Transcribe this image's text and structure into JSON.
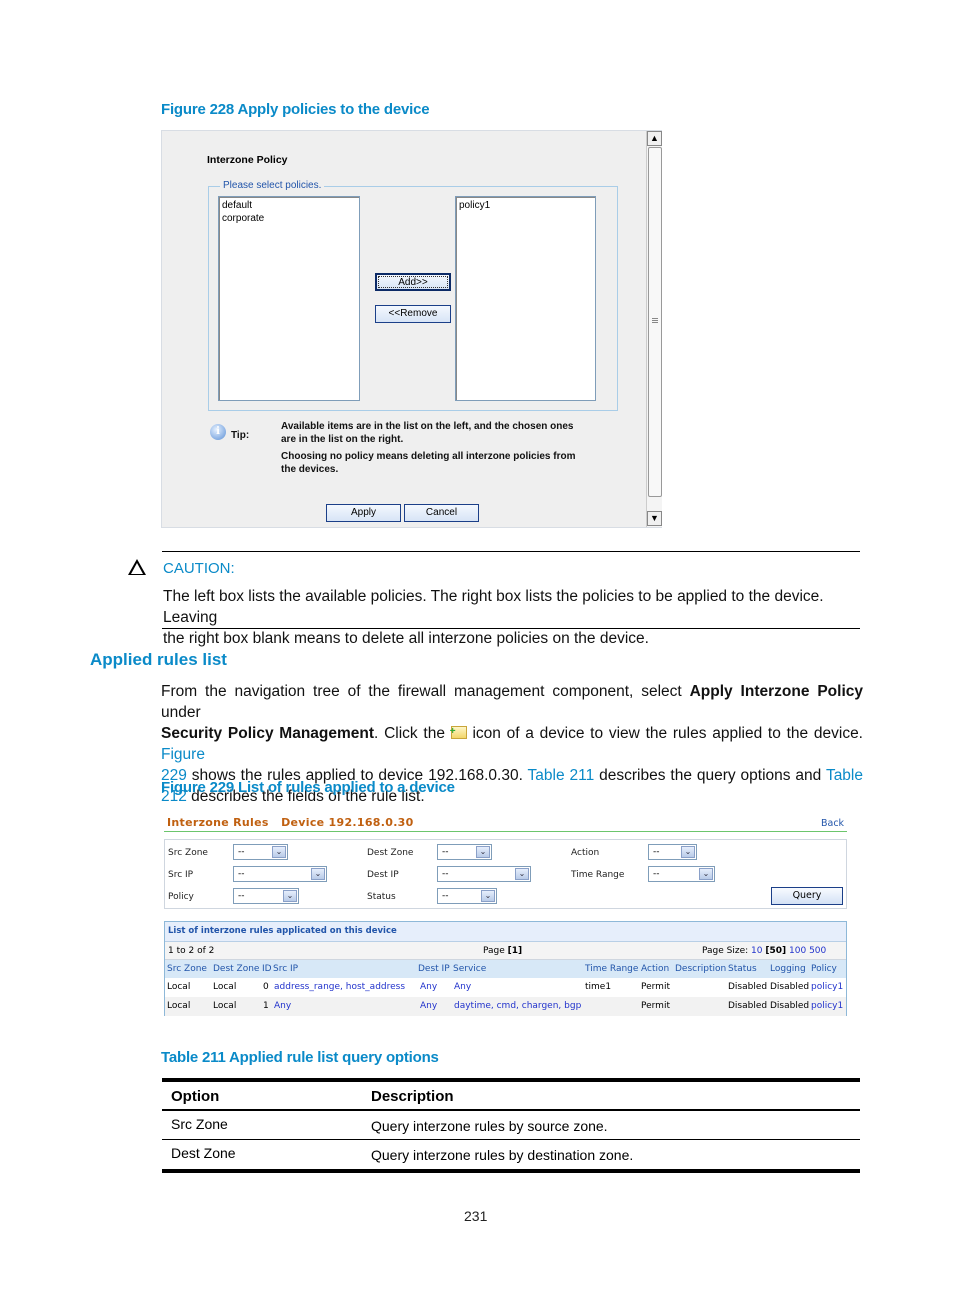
{
  "figure228": {
    "caption": "Figure 228 Apply policies to the device",
    "dialog_title": "Interzone Policy",
    "fieldset_legend": "Please select policies.",
    "available_list": [
      "default",
      "corporate"
    ],
    "selected_list": [
      "policy1"
    ],
    "add_button": "Add>>",
    "remove_button": "<<Remove",
    "tip_label": "Tip:",
    "tip_line1": "Available items are in the list on the left, and the chosen ones",
    "tip_line2": "are in the list on the right.",
    "tip_line3": "Choosing no policy means deleting all interzone policies from",
    "tip_line4": "the devices.",
    "apply_button": "Apply",
    "cancel_button": "Cancel",
    "scroll_up": "▲",
    "scroll_down": "▼"
  },
  "caution": {
    "label": "CAUTION:",
    "line1": "The left box lists the available policies. The right box lists the policies to be applied to the device. Leaving",
    "line2": "the right box blank means to delete all interzone policies on the device."
  },
  "section": {
    "heading": "Applied rules list",
    "p1_a": "From the navigation tree of the firewall management component, select ",
    "p1_bold1": "Apply Interzone Policy",
    "p1_b": " under",
    "p2_bold": "Security Policy Management",
    "p2_a": ". Click the ",
    "p2_b": " icon of a device to view the rules applied to the device. ",
    "p2_link": "Figure",
    "p3_link1": "229",
    "p3_a": " shows the rules applied to device 192.168.0.30. ",
    "p3_link2": "Table 211",
    "p3_b": " describes the query options and ",
    "p3_link3": "Table",
    "p4_link": "212",
    "p4_a": " describes the fields of the rule list."
  },
  "figure229": {
    "caption": "Figure 229 List of rules applied to a device",
    "title": "Interzone Rules   Device 192.168.0.30",
    "back_link": "Back",
    "query": {
      "src_zone_label": "Src Zone",
      "src_zone_value": "--",
      "dest_zone_label": "Dest Zone",
      "dest_zone_value": "--",
      "action_label": "Action",
      "action_value": "--",
      "src_ip_label": "Src IP",
      "src_ip_value": "--",
      "dest_ip_label": "Dest IP",
      "dest_ip_value": "--",
      "time_range_label": "Time Range",
      "time_range_value": "--",
      "policy_label": "Policy",
      "policy_value": "--",
      "status_label": "Status",
      "status_value": "--",
      "query_button": "Query"
    },
    "list_title": "List of interzone rules applicated on this device",
    "range_text": "1 to 2 of 2",
    "page_label": "Page",
    "page_current": "[1]",
    "page_size_label": "Page Size:",
    "page_sizes": [
      "10",
      "[50]",
      "100",
      "500"
    ],
    "columns": [
      "Src Zone",
      "Dest Zone",
      "ID",
      "Src IP",
      "Dest IP",
      "Service",
      "Time Range",
      "Action",
      "Description",
      "Status",
      "Logging",
      "Policy"
    ],
    "rows": [
      {
        "src_zone": "Local",
        "dest_zone": "Local",
        "id": "0",
        "src_ip": "address_range, host_address",
        "dest_ip": "Any",
        "service": "Any",
        "time_range": "time1",
        "action": "Permit",
        "description": "",
        "status": "Disabled",
        "logging": "Disabled",
        "policy": "policy1"
      },
      {
        "src_zone": "Local",
        "dest_zone": "Local",
        "id": "1",
        "src_ip": "Any",
        "dest_ip": "Any",
        "service": "daytime, cmd, chargen, bgp",
        "time_range": "",
        "action": "Permit",
        "description": "",
        "status": "Disabled",
        "logging": "Disabled",
        "policy": "policy1"
      }
    ]
  },
  "table211": {
    "caption": "Table 211 Applied rule list query options",
    "headers": [
      "Option",
      "Description"
    ],
    "rows": [
      [
        "Src Zone",
        "Query interzone rules by source zone."
      ],
      [
        "Dest Zone",
        "Query interzone rules by destination zone."
      ]
    ]
  },
  "page_number": "231"
}
